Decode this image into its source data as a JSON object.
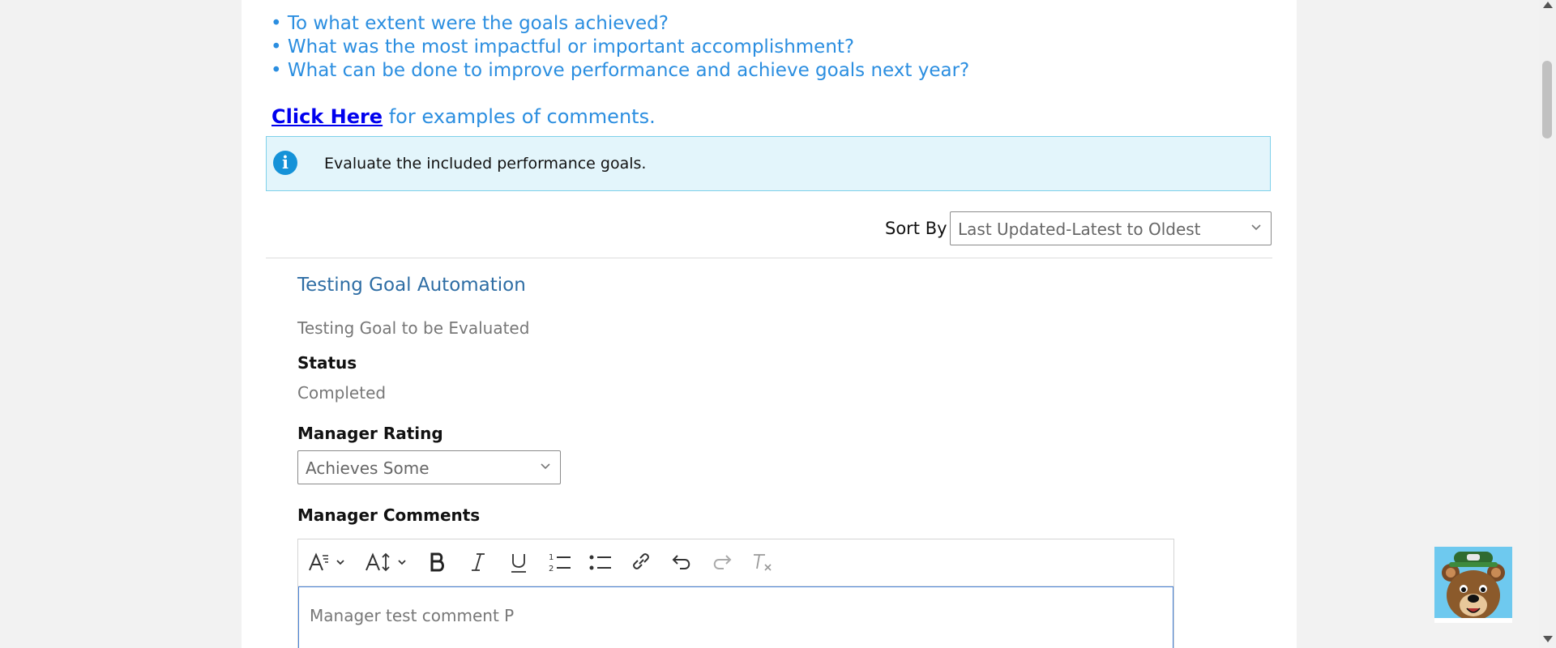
{
  "guidance": {
    "bullets": [
      "• To what extent were the goals achieved?",
      "• What was the most impactful or important accomplishment?",
      "• What can be done to improve performance and achieve goals next year?"
    ],
    "link_label": "Click Here",
    "link_suffix": " for examples of comments."
  },
  "info": {
    "icon": "info-icon",
    "message": "Evaluate the included performance goals."
  },
  "sort": {
    "label": "Sort By",
    "selected": "Last Updated-Latest to Oldest"
  },
  "goal": {
    "title": "Testing Goal Automation",
    "description": "Testing Goal to be Evaluated",
    "status_label": "Status",
    "status_value": "Completed",
    "rating_label": "Manager Rating",
    "rating_selected": "Achieves Some",
    "comments_label": "Manager Comments",
    "comment_text": "Manager test comment P"
  },
  "editor_toolbar": [
    "font-style-icon",
    "font-size-icon",
    "bold-icon",
    "italic-icon",
    "underline-icon",
    "numbered-list-icon",
    "bullet-list-icon",
    "link-icon",
    "undo-icon",
    "redo-icon",
    "clear-format-icon"
  ],
  "colors": {
    "link_blue": "#2b8ee0",
    "hyperlink": "#0000ee",
    "goal_title": "#2e6da4",
    "info_bg": "#e3f5fb",
    "info_icon": "#1592d8",
    "editor_focus": "#4a84d8"
  }
}
